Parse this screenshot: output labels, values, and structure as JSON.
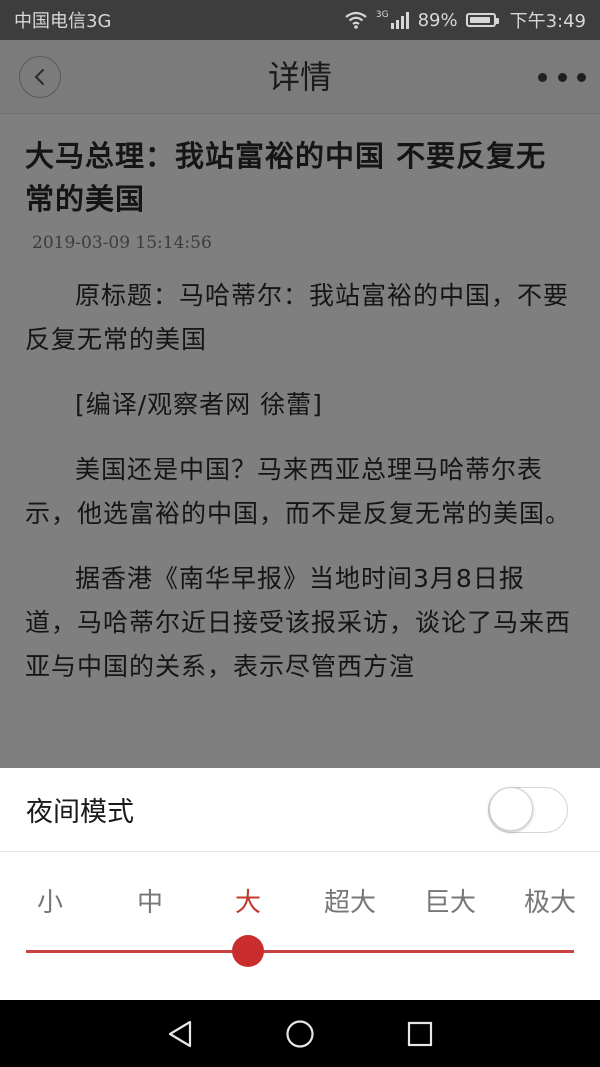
{
  "status_bar": {
    "carrier": "中国电信3G",
    "network": "3G",
    "battery": "89%",
    "battery_level": 0.89,
    "time": "下午3:49",
    "icons": [
      "wifi-icon",
      "signal-icon",
      "battery-icon"
    ]
  },
  "nav": {
    "title": "详情",
    "back_icon": "chevron-left-icon",
    "more_icon": "more-dots-icon"
  },
  "article": {
    "title": "大马总理：我站富裕的中国  不要反复无常的美国",
    "date": "2019-03-09  15:14:56",
    "paragraphs": [
      "原标题：马哈蒂尔：我站富裕的中国，不要反复无常的美国",
      " [编译/观察者网  徐蕾]",
      "美国还是中国？马来西亚总理马哈蒂尔表示，他选富裕的中国，而不是反复无常的美国。",
      "据香港《南华早报》当地时间3月8日报道，马哈蒂尔近日接受该报采访，谈论了马来西亚与中国的关系，表示尽管西方渲"
    ]
  },
  "settings_sheet": {
    "night_mode_label": "夜间模式",
    "night_mode_on": false,
    "font_sizes": [
      "小",
      "中",
      "大",
      "超大",
      "巨大",
      "极大"
    ],
    "selected_size_index": 2,
    "accent_color": "#c92d2d"
  },
  "system_nav": {
    "icons": [
      "back-triangle-icon",
      "home-circle-icon",
      "recents-square-icon"
    ]
  }
}
